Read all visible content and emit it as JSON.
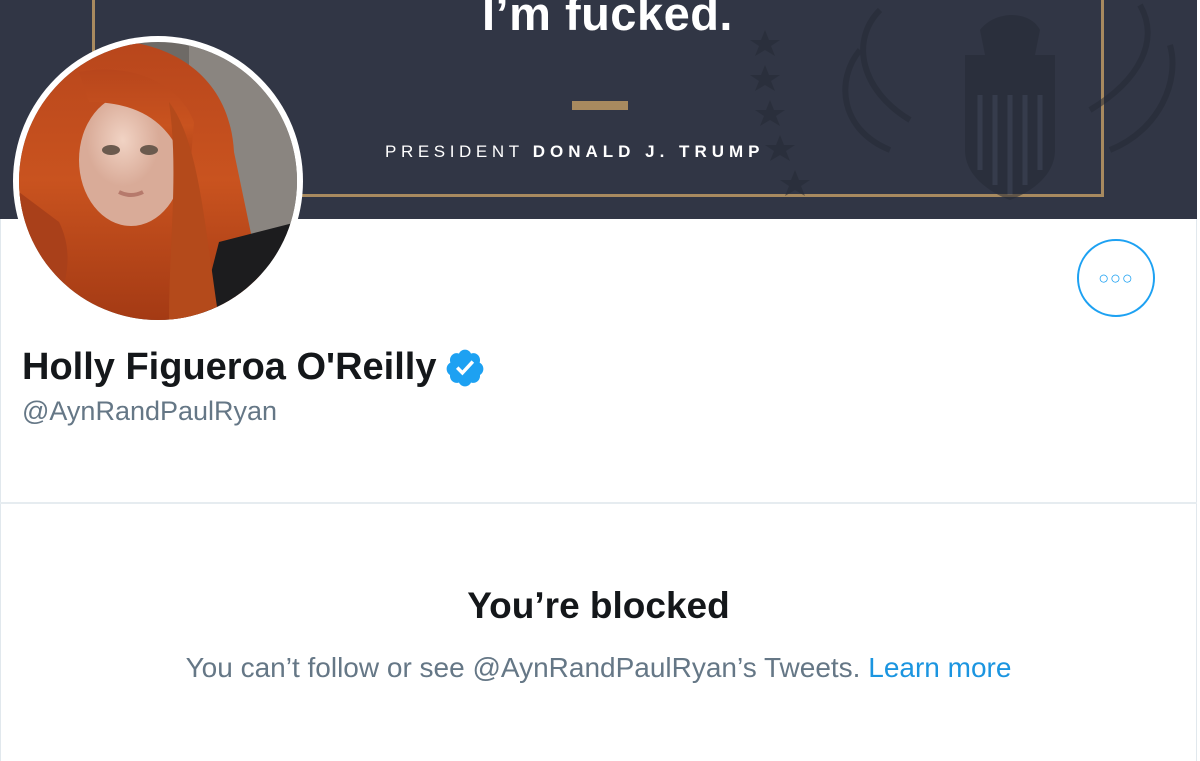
{
  "banner": {
    "quote": "I’m fucked.",
    "attribution_prefix": "PRESIDENT",
    "attribution_name": "DONALD J. TRUMP",
    "background_color": "#313645",
    "accent_color": "#a88a5f"
  },
  "profile": {
    "display_name": "Holly Figueroa O'Reilly",
    "handle": "@AynRandPaulRyan",
    "verified": true,
    "verified_icon": "verified-badge-icon",
    "avatar_icon": "profile-photo"
  },
  "actions": {
    "more_icon": "more-options-icon"
  },
  "blocked": {
    "title": "You’re blocked",
    "message": "You can’t follow or see @AynRandPaulRyan’s Tweets.",
    "link_label": "Learn more"
  },
  "colors": {
    "accent": "#1da1f2",
    "link": "#1b95e0",
    "secondary_text": "#657786",
    "primary_text": "#14171a"
  }
}
